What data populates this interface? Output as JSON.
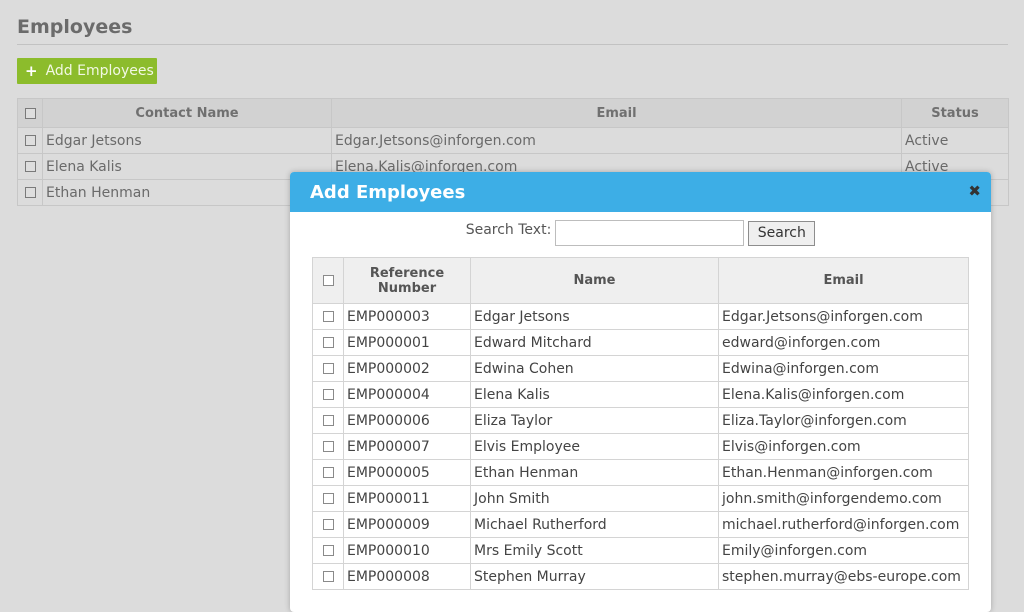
{
  "page": {
    "title": "Employees",
    "add_button_label": "Add Employees"
  },
  "bg_table": {
    "headers": [
      "Contact Name",
      "Email",
      "Status"
    ],
    "rows": [
      {
        "name": "Edgar Jetsons",
        "email": "Edgar.Jetsons@inforgen.com",
        "status": "Active"
      },
      {
        "name": "Elena Kalis",
        "email": "Elena.Kalis@inforgen.com",
        "status": "Active"
      },
      {
        "name": "Ethan Henman",
        "email": "",
        "status": ""
      }
    ]
  },
  "modal": {
    "title": "Add Employees",
    "close_glyph": "✖",
    "search_label": "Search Text:",
    "search_value": "",
    "search_button": "Search",
    "headers": [
      "Reference Number",
      "Name",
      "Email"
    ],
    "rows": [
      {
        "ref": "EMP000003",
        "name": "Edgar Jetsons",
        "email": "Edgar.Jetsons@inforgen.com"
      },
      {
        "ref": "EMP000001",
        "name": "Edward Mitchard",
        "email": "edward@inforgen.com"
      },
      {
        "ref": "EMP000002",
        "name": "Edwina Cohen",
        "email": "Edwina@inforgen.com"
      },
      {
        "ref": "EMP000004",
        "name": "Elena Kalis",
        "email": "Elena.Kalis@inforgen.com"
      },
      {
        "ref": "EMP000006",
        "name": "Eliza Taylor",
        "email": "Eliza.Taylor@inforgen.com"
      },
      {
        "ref": "EMP000007",
        "name": "Elvis Employee",
        "email": "Elvis@inforgen.com"
      },
      {
        "ref": "EMP000005",
        "name": "Ethan Henman",
        "email": "Ethan.Henman@inforgen.com"
      },
      {
        "ref": "EMP000011",
        "name": "John Smith",
        "email": "john.smith@inforgendemo.com"
      },
      {
        "ref": "EMP000009",
        "name": "Michael Rutherford",
        "email": "michael.rutherford@inforgen.com"
      },
      {
        "ref": "EMP000010",
        "name": "Mrs Emily Scott",
        "email": "Emily@inforgen.com"
      },
      {
        "ref": "EMP000008",
        "name": "Stephen Murray",
        "email": "stephen.murray@ebs-europe.com"
      }
    ]
  },
  "colors": {
    "accent": "#3daee6",
    "add_button": "#8cbc2c"
  }
}
